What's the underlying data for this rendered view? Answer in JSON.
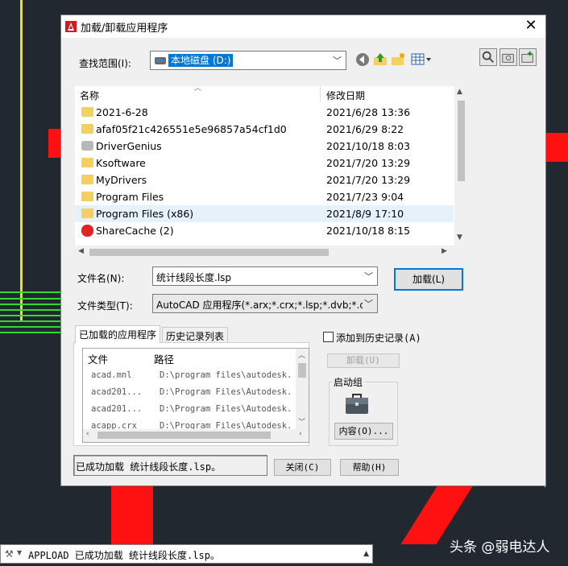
{
  "dialog": {
    "title": "加载/卸载应用程序",
    "close_glyph": "✕",
    "look_in_label": "查找范围(I):",
    "look_in_value": "本地磁盘 (D:)",
    "file_list": {
      "col_name": "名称",
      "col_modified": "修改日期",
      "rows": [
        {
          "name": "2021-6-28",
          "date": "2021/6/28 13:36",
          "icon": "folder-icon"
        },
        {
          "name": "afaf05f21c426551e5e96857a54cf1d0",
          "date": "2021/6/29 8:22",
          "icon": "folder-icon"
        },
        {
          "name": "DriverGenius",
          "date": "2021/10/18 8:03",
          "icon": "gear-folder-icon"
        },
        {
          "name": "Ksoftware",
          "date": "2021/7/20 13:29",
          "icon": "folder-icon"
        },
        {
          "name": "MyDrivers",
          "date": "2021/7/20 13:29",
          "icon": "folder-icon"
        },
        {
          "name": "Program Files",
          "date": "2021/7/23 9:04",
          "icon": "folder-icon"
        },
        {
          "name": "Program Files (x86)",
          "date": "2021/8/9 17:10",
          "icon": "folder-icon"
        },
        {
          "name": "ShareCache (2)",
          "date": "2021/10/18 8:15",
          "icon": "sharecache-icon"
        }
      ],
      "selected_index": 6
    },
    "filename_label": "文件名(N):",
    "filename_value": "统计线段长度.lsp",
    "filetype_label": "文件类型(T):",
    "filetype_value": "AutoCAD 应用程序(*.arx;*.crx;*.lsp;*.dvb;*.dbx",
    "load_button": "加载(L)",
    "tabs": [
      "已加载的应用程序",
      "历史记录列表"
    ],
    "active_tab": 0,
    "loaded_apps": {
      "col_file": "文件",
      "col_path": "路径",
      "rows": [
        {
          "file": "acad.mnl",
          "path": "D:\\program files\\autodesk..."
        },
        {
          "file": "acad201...",
          "path": "D:\\Program Files\\Autodesk..."
        },
        {
          "file": "acad201...",
          "path": "D:\\Program Files\\Autodesk..."
        },
        {
          "file": "acapp.crx",
          "path": "D:\\Program Files\\Autodesk..."
        }
      ]
    },
    "add_history_label": "添加到历史记录(A)",
    "add_history_checked": false,
    "unload_button": "卸载(U)",
    "startup_group_label": "启动组",
    "contents_button": "内容(O)...",
    "status_text": "已成功加载 统计线段长度.lsp。",
    "close_button": "关闭(C)",
    "help_button": "帮助(H)"
  },
  "command_line": {
    "text": "APPLOAD 已成功加载 统计线段长度.lsp。"
  },
  "watermark": "头条 @弱电达人",
  "colors": {
    "cad_background": "#212830",
    "selection_blue": "#0078d7",
    "cad_red": "#ff1111",
    "cad_yellow": "#e8e800",
    "cad_green": "#2fdc2f"
  }
}
